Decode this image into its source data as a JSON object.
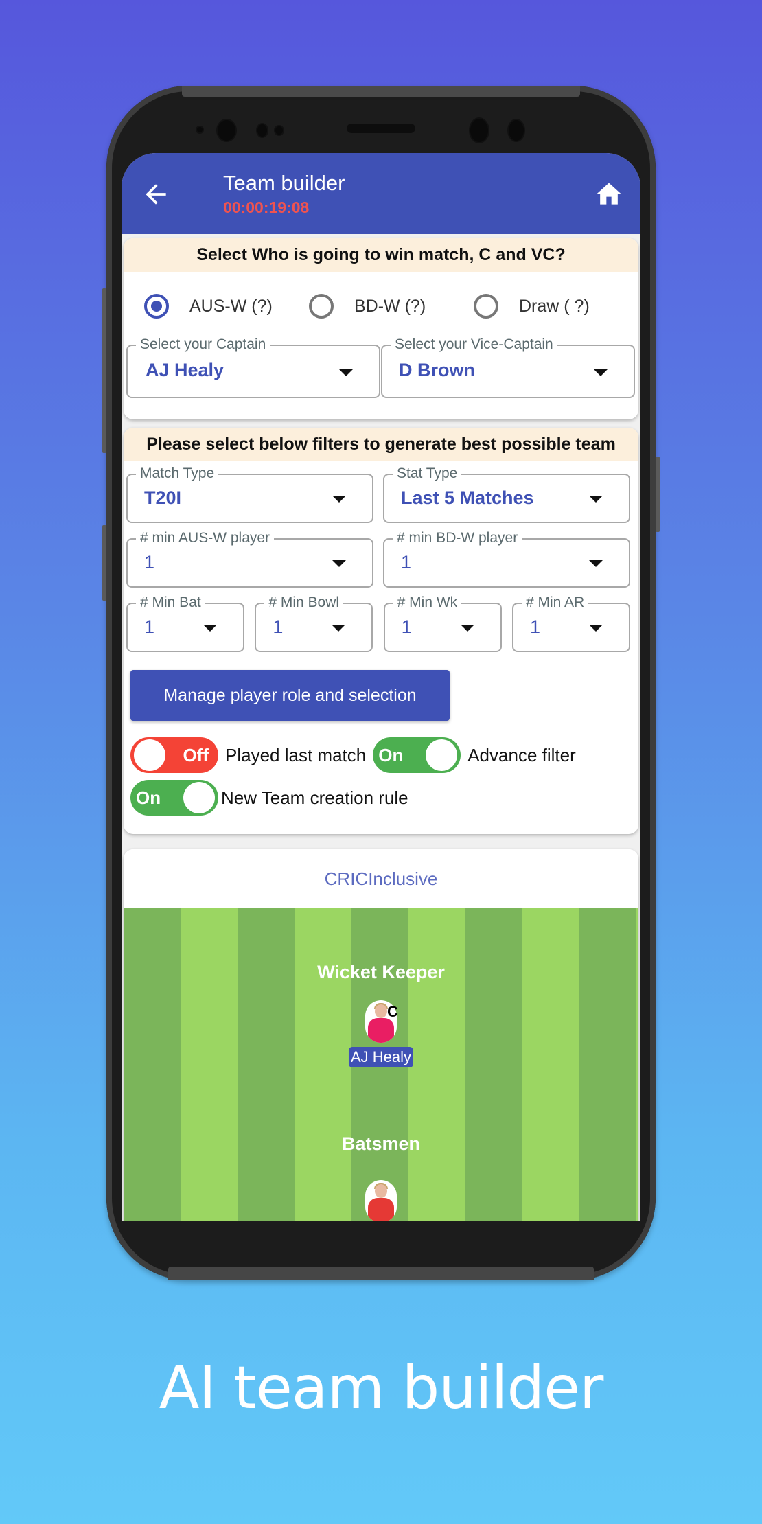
{
  "appbar": {
    "title": "Team builder",
    "timer": "00:00:19:08",
    "back_icon": "arrow-left-icon",
    "home_icon": "home-icon"
  },
  "prediction": {
    "header": "Select Who is going to win match, C and VC?",
    "options": [
      {
        "label": "AUS-W (?)",
        "selected": true
      },
      {
        "label": "BD-W (?)",
        "selected": false
      },
      {
        "label": "Draw ( ?)",
        "selected": false
      }
    ],
    "captain": {
      "label": "Select your Captain",
      "value": "AJ Healy"
    },
    "vice_captain": {
      "label": "Select your Vice-Captain",
      "value": "D Brown"
    }
  },
  "filters": {
    "header": "Please select below filters to generate best possible team",
    "match_type": {
      "label": "Match Type",
      "value": "T20I"
    },
    "stat_type": {
      "label": "Stat Type",
      "value": "Last 5 Matches"
    },
    "min_team1": {
      "label": "# min AUS-W player",
      "value": "1"
    },
    "min_team2": {
      "label": "# min BD-W player",
      "value": "1"
    },
    "min_bat": {
      "label": "# Min Bat",
      "value": "1"
    },
    "min_bowl": {
      "label": "# Min Bowl",
      "value": "1"
    },
    "min_wk": {
      "label": "# Min Wk",
      "value": "1"
    },
    "min_ar": {
      "label": "# Min AR",
      "value": "1"
    },
    "manage_button": "Manage player role and selection",
    "toggles": [
      {
        "state_text": "Off",
        "on": false,
        "label": "Played last match"
      },
      {
        "state_text": "On",
        "on": true,
        "label": "Advance filter"
      },
      {
        "state_text": "On",
        "on": true,
        "label": "New Team creation rule"
      }
    ]
  },
  "team": {
    "brand": "CRICInclusive",
    "sections": [
      {
        "title": "Wicket Keeper",
        "players": [
          {
            "name": "AJ Healy",
            "badge": "C",
            "jersey": "#e91e63"
          }
        ]
      },
      {
        "title": "Batsmen",
        "players": [
          {
            "name": "",
            "badge": "",
            "jersey": "#e53935"
          }
        ]
      }
    ]
  },
  "colors": {
    "primary": "#3f51b5",
    "timer": "#ef5350",
    "toggle_on": "#4caf50",
    "toggle_off": "#f44336",
    "header_band": "#fcefdc"
  },
  "caption": "AI team builder"
}
